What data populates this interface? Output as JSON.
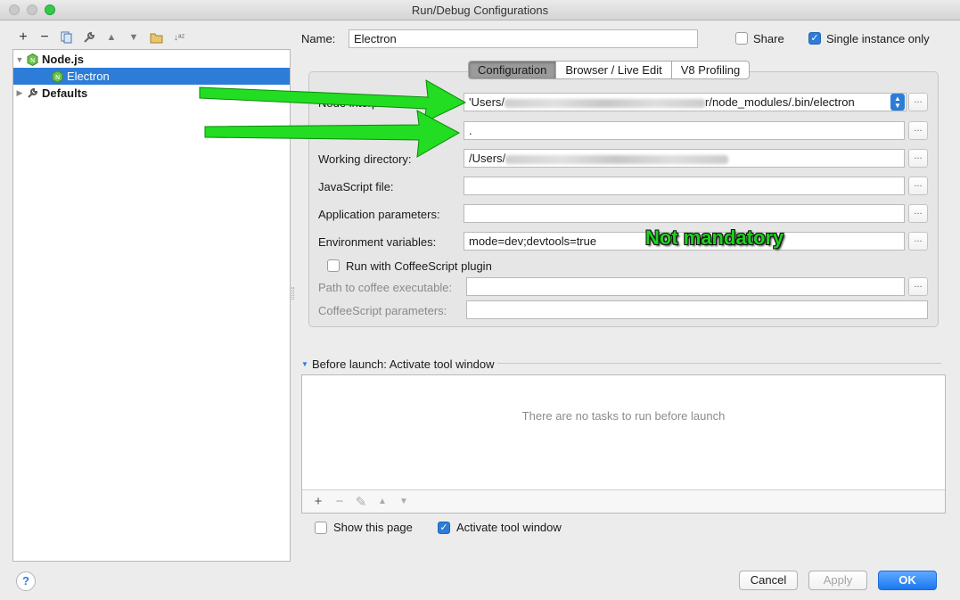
{
  "window": {
    "title": "Run/Debug Configurations"
  },
  "toolbar": {
    "icons": [
      "add-icon",
      "remove-icon",
      "copy-icon",
      "wrench-icon",
      "move-up-icon",
      "move-down-icon",
      "folder-icon",
      "sort-icon"
    ]
  },
  "tree": {
    "items": [
      {
        "label": "Node.js",
        "icon": "nodejs-icon",
        "expanded": true
      },
      {
        "label": "Electron",
        "icon": "nodejs-icon",
        "selected": true
      },
      {
        "label": "Defaults",
        "icon": "wrench-icon",
        "expanded": false
      }
    ]
  },
  "header": {
    "name_label": "Name:",
    "name_value": "Electron",
    "share_label": "Share",
    "share_checked": false,
    "single_instance_label": "Single instance only",
    "single_instance_checked": true
  },
  "tabs": [
    {
      "label": "Configuration",
      "active": true
    },
    {
      "label": "Browser / Live Edit",
      "active": false
    },
    {
      "label": "V8 Profiling",
      "active": false
    }
  ],
  "form": {
    "node_interpreter": {
      "label": "Node interpreter:",
      "label_visible": "Node interprete",
      "value_prefix": "'Users/",
      "value_suffix": "r/node_modules/.bin/electron"
    },
    "node_params": {
      "label_visible": "No",
      "value": "."
    },
    "working_directory": {
      "label": "Working directory:",
      "value_prefix": "/Users/"
    },
    "javascript_file": {
      "label": "JavaScript file:",
      "value": ""
    },
    "application_parameters": {
      "label": "Application parameters:",
      "value": ""
    },
    "environment_variables": {
      "label": "Environment variables:",
      "value": "mode=dev;devtools=true"
    },
    "coffeescript": {
      "label": "Run with CoffeeScript plugin",
      "checked": false
    },
    "coffee_path": {
      "label": "Path to coffee executable:",
      "value": ""
    },
    "coffee_params": {
      "label": "CoffeeScript parameters:",
      "value": ""
    },
    "browse_label": "..."
  },
  "annotation": {
    "text": "Not mandatory",
    "color": "#1fd01f"
  },
  "before_launch": {
    "title": "Before launch: Activate tool window",
    "empty_text": "There are no tasks to run before launch",
    "toolbar": [
      "+",
      "−",
      "✎",
      "▲",
      "▼"
    ]
  },
  "options": {
    "show_page_label": "Show this page",
    "show_page_checked": false,
    "activate_tool_label": "Activate tool window",
    "activate_tool_checked": true
  },
  "buttons": {
    "cancel": "Cancel",
    "apply": "Apply",
    "ok": "OK",
    "help": "?"
  },
  "colors": {
    "selection": "#2d7cd8",
    "arrow": "#22dd22"
  }
}
